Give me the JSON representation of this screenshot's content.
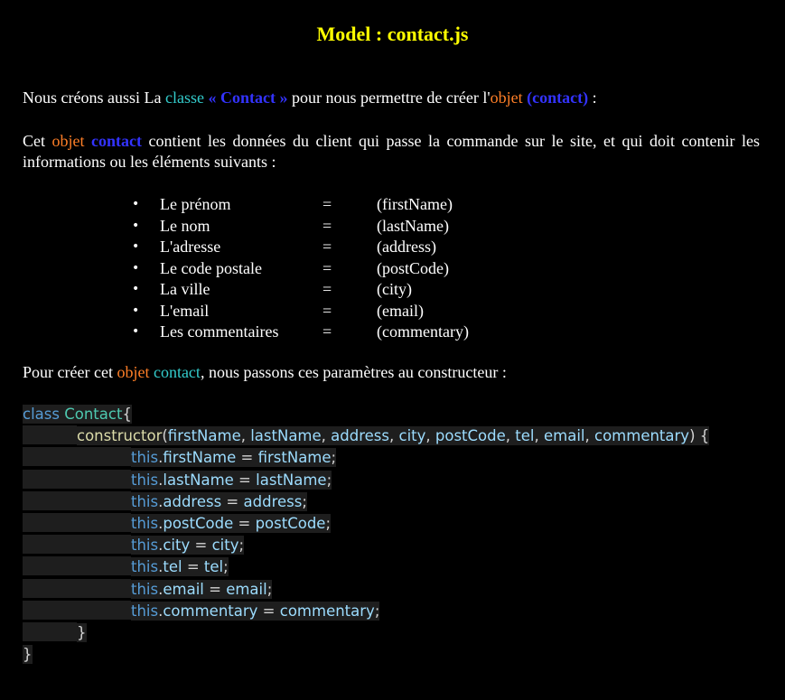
{
  "title": "Model : contact.js",
  "para1": {
    "t1": "Nous créons aussi La ",
    "t2": "classe",
    "t3": " « Contact »",
    "t4": " pour nous permettre de créer l'",
    "t5": "objet",
    "t6": " (contact)",
    "t7": " :"
  },
  "para2": {
    "t1": "Cet ",
    "t2": "objet",
    "t3": " contact",
    "t4": " contient les données du client qui passe la commande sur le site, et qui doit contenir les informations ou les éléments suivants :"
  },
  "fields": [
    {
      "label": "Le prénom",
      "eq": "=",
      "prop": "(firstName)"
    },
    {
      "label": "Le nom",
      "eq": "=",
      "prop": "(lastName)"
    },
    {
      "label": "L'adresse",
      "eq": "=",
      "prop": "(address)"
    },
    {
      "label": "Le code postale",
      "eq": "=",
      "prop": "(postCode)"
    },
    {
      "label": "La ville",
      "eq": "=",
      "prop": "(city)"
    },
    {
      "label": "L'email",
      "eq": "=",
      "prop": "(email)"
    },
    {
      "label": "Les commentaires",
      "eq": "=",
      "prop": "(commentary)"
    }
  ],
  "para3": {
    "t1": "Pour créer cet ",
    "t2": "objet",
    "t3": " contact",
    "t4": ", nous passons ces paramètres au constructeur :"
  },
  "code": {
    "class_kw": "class",
    "class_name": "Contact",
    "open_brace": "{",
    "ctor_name": "constructor",
    "ctor_params": [
      "firstName",
      "lastName",
      "address",
      "city",
      "postCode",
      "tel",
      "email",
      "commentary"
    ],
    "this_kw": "this",
    "assignments": [
      "firstName",
      "lastName",
      "address",
      "postCode",
      "city",
      "tel",
      "email",
      "commentary"
    ],
    "close_inner": "}",
    "close_outer": "}"
  },
  "colors": {
    "background": "#000000",
    "title": "#ffff00",
    "orange": "#ff7f27",
    "cyan": "#33cccc",
    "blue": "#3333ff",
    "code_bg": "#1e1e1e"
  }
}
